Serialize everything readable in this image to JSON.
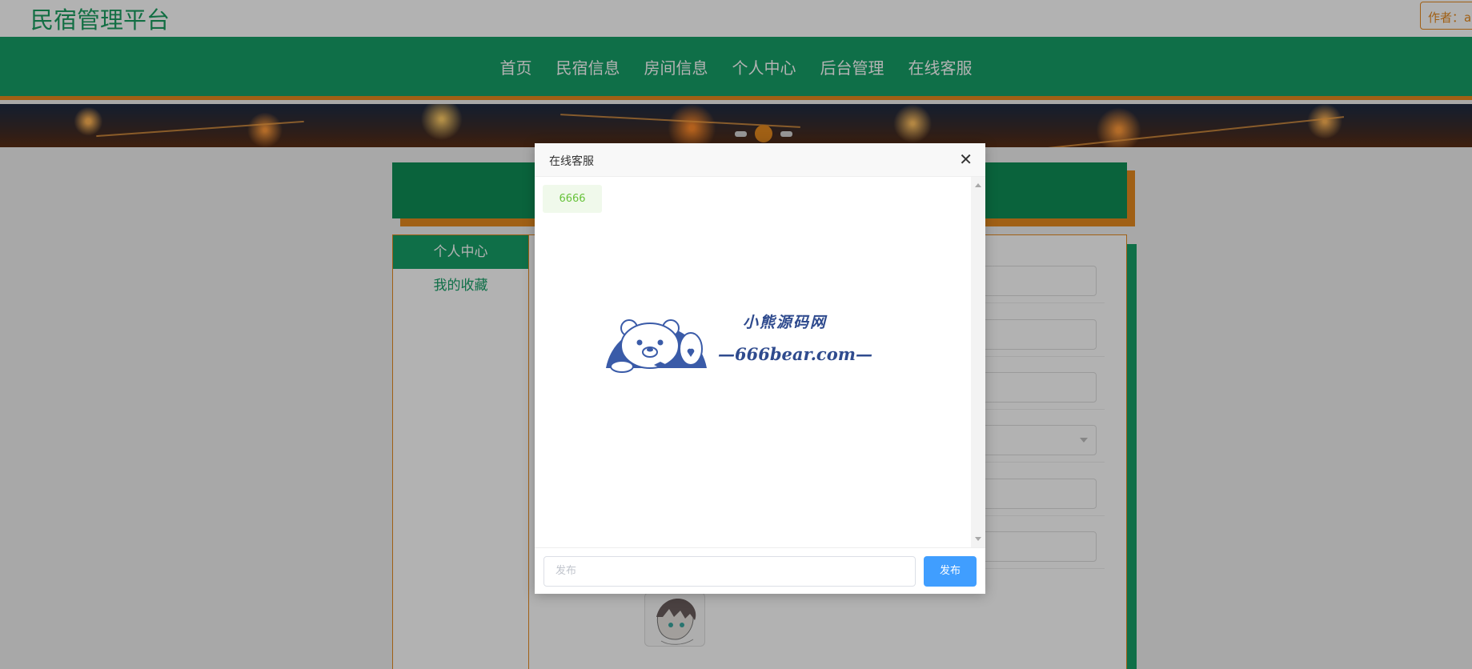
{
  "header": {
    "site_title": "民宿管理平台",
    "author_label": "作者：a"
  },
  "nav": {
    "items": [
      "首页",
      "民宿信息",
      "房间信息",
      "个人中心",
      "后台管理",
      "在线客服"
    ]
  },
  "sidebar": {
    "heading": "个人中心",
    "items": [
      "我的收藏"
    ]
  },
  "modal": {
    "title": "在线客服",
    "messages": [
      "6666"
    ],
    "input_placeholder": "发布",
    "send_label": "发布"
  },
  "watermark": {
    "cn": "小熊源码网",
    "en": "—666bear.com—"
  },
  "colors": {
    "primary_green": "#16a067",
    "accent_orange": "#e68a1f",
    "send_blue": "#409eff"
  }
}
